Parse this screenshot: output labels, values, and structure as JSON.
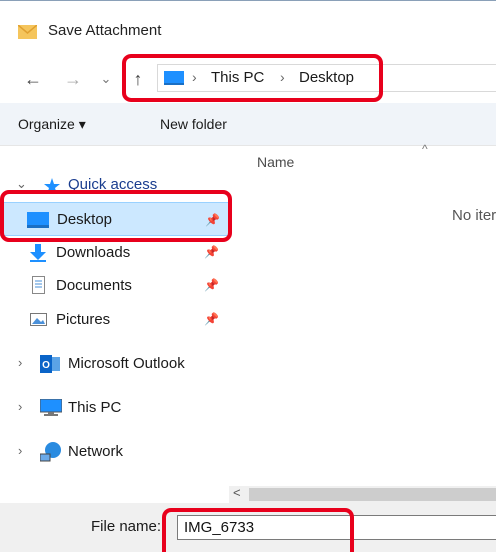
{
  "window": {
    "title": "Save Attachment"
  },
  "nav": {
    "back": "←",
    "forward": "→",
    "recent": "⌄",
    "up": "↑",
    "breadcrumbs": [
      "This PC",
      "Desktop"
    ],
    "separator": "›"
  },
  "toolbar": {
    "organize": "Organize ▾",
    "new_folder": "New folder"
  },
  "sidebar": {
    "quick_access": "Quick access",
    "items": [
      {
        "label": "Desktop",
        "pinned": "📌"
      },
      {
        "label": "Downloads",
        "pinned": "📌"
      },
      {
        "label": "Documents",
        "pinned": "📌"
      },
      {
        "label": "Pictures",
        "pinned": "📌"
      }
    ],
    "outlook": "Microsoft Outlook",
    "this_pc": "This PC",
    "network": "Network"
  },
  "content": {
    "column_name": "Name",
    "sort": "^",
    "empty": "No iter"
  },
  "scroll": {
    "left_arrow": "<"
  },
  "footer": {
    "file_name_label": "File name:",
    "file_name_value": "IMG_6733"
  },
  "colors": {
    "highlight": "#e8001c",
    "selection": "#cce8ff",
    "folder_blue": "#1e90ff"
  }
}
